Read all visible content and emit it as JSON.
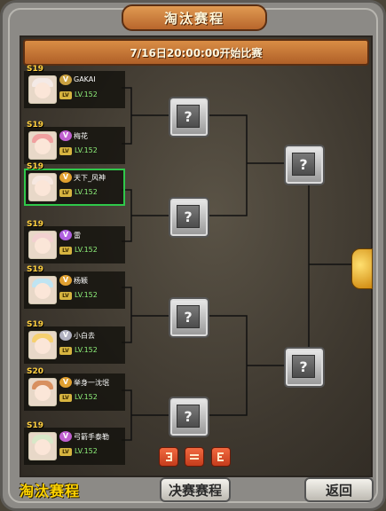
{
  "title": "淘汰赛程",
  "date_banner": "7/16日20:00:00开始比赛",
  "players": [
    {
      "server": "S19",
      "name": "GAKAI",
      "vip": "",
      "level": "LV.152",
      "hair": "#f4eae6",
      "badge": "#c9a040"
    },
    {
      "server": "S19",
      "name": "梅花",
      "vip": "",
      "level": "LV.152",
      "hair": "#f0a0a0",
      "badge": "#c060d0"
    },
    {
      "server": "S19",
      "name": "天下_风神",
      "vip": "",
      "level": "LV.152",
      "hair": "#f6e8e0",
      "badge": "#e0a030"
    },
    {
      "server": "S19",
      "name": "雷",
      "vip": "",
      "level": "LV.152",
      "hair": "#f2d0d0",
      "badge": "#b060e0"
    },
    {
      "server": "S19",
      "name": "杨颖",
      "vip": "",
      "level": "LV.152",
      "hair": "#bfe4f2",
      "badge": "#e0a030"
    },
    {
      "server": "S19",
      "name": "小白去",
      "vip": "",
      "level": "LV.152",
      "hair": "#f6d070",
      "badge": "#b0b0c0"
    },
    {
      "server": "S20",
      "name": "举身一沈氓",
      "vip": "",
      "level": "LV.152",
      "hair": "#d89060",
      "badge": "#e0a030"
    },
    {
      "server": "S19",
      "name": "弓箭手泰勒",
      "vip": "",
      "level": "LV.152",
      "hair": "#d8e8c8",
      "badge": "#c060d0"
    }
  ],
  "bracket_unknown": "?",
  "page_buttons": [
    "",
    "",
    ""
  ],
  "bottom": {
    "tab_active": "淘汰赛程",
    "tab_final": "决赛赛程",
    "back": "返回"
  },
  "colors": {
    "accent": "#2fc84a",
    "level": "#8ef07a",
    "server": "#ffd040"
  },
  "selected_player": 2
}
